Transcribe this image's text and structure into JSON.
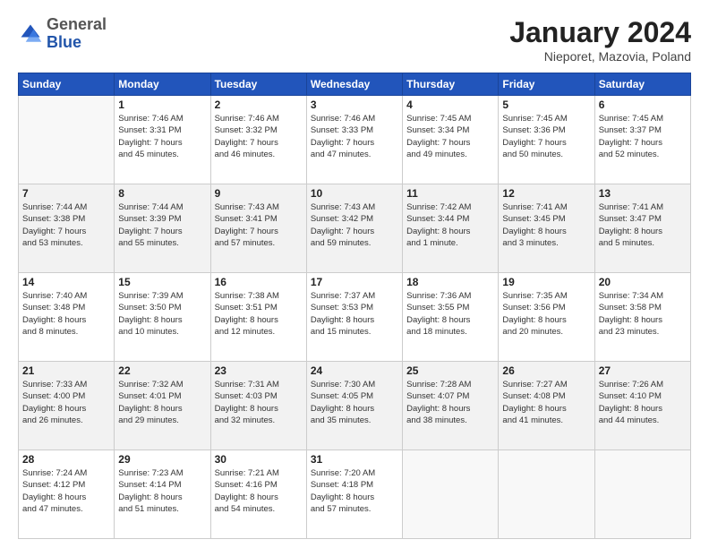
{
  "header": {
    "logo_general": "General",
    "logo_blue": "Blue",
    "title": "January 2024",
    "subtitle": "Nieporet, Mazovia, Poland"
  },
  "days_of_week": [
    "Sunday",
    "Monday",
    "Tuesday",
    "Wednesday",
    "Thursday",
    "Friday",
    "Saturday"
  ],
  "weeks": [
    [
      {
        "num": "",
        "info": ""
      },
      {
        "num": "1",
        "info": "Sunrise: 7:46 AM\nSunset: 3:31 PM\nDaylight: 7 hours\nand 45 minutes."
      },
      {
        "num": "2",
        "info": "Sunrise: 7:46 AM\nSunset: 3:32 PM\nDaylight: 7 hours\nand 46 minutes."
      },
      {
        "num": "3",
        "info": "Sunrise: 7:46 AM\nSunset: 3:33 PM\nDaylight: 7 hours\nand 47 minutes."
      },
      {
        "num": "4",
        "info": "Sunrise: 7:45 AM\nSunset: 3:34 PM\nDaylight: 7 hours\nand 49 minutes."
      },
      {
        "num": "5",
        "info": "Sunrise: 7:45 AM\nSunset: 3:36 PM\nDaylight: 7 hours\nand 50 minutes."
      },
      {
        "num": "6",
        "info": "Sunrise: 7:45 AM\nSunset: 3:37 PM\nDaylight: 7 hours\nand 52 minutes."
      }
    ],
    [
      {
        "num": "7",
        "info": "Sunrise: 7:44 AM\nSunset: 3:38 PM\nDaylight: 7 hours\nand 53 minutes."
      },
      {
        "num": "8",
        "info": "Sunrise: 7:44 AM\nSunset: 3:39 PM\nDaylight: 7 hours\nand 55 minutes."
      },
      {
        "num": "9",
        "info": "Sunrise: 7:43 AM\nSunset: 3:41 PM\nDaylight: 7 hours\nand 57 minutes."
      },
      {
        "num": "10",
        "info": "Sunrise: 7:43 AM\nSunset: 3:42 PM\nDaylight: 7 hours\nand 59 minutes."
      },
      {
        "num": "11",
        "info": "Sunrise: 7:42 AM\nSunset: 3:44 PM\nDaylight: 8 hours\nand 1 minute."
      },
      {
        "num": "12",
        "info": "Sunrise: 7:41 AM\nSunset: 3:45 PM\nDaylight: 8 hours\nand 3 minutes."
      },
      {
        "num": "13",
        "info": "Sunrise: 7:41 AM\nSunset: 3:47 PM\nDaylight: 8 hours\nand 5 minutes."
      }
    ],
    [
      {
        "num": "14",
        "info": "Sunrise: 7:40 AM\nSunset: 3:48 PM\nDaylight: 8 hours\nand 8 minutes."
      },
      {
        "num": "15",
        "info": "Sunrise: 7:39 AM\nSunset: 3:50 PM\nDaylight: 8 hours\nand 10 minutes."
      },
      {
        "num": "16",
        "info": "Sunrise: 7:38 AM\nSunset: 3:51 PM\nDaylight: 8 hours\nand 12 minutes."
      },
      {
        "num": "17",
        "info": "Sunrise: 7:37 AM\nSunset: 3:53 PM\nDaylight: 8 hours\nand 15 minutes."
      },
      {
        "num": "18",
        "info": "Sunrise: 7:36 AM\nSunset: 3:55 PM\nDaylight: 8 hours\nand 18 minutes."
      },
      {
        "num": "19",
        "info": "Sunrise: 7:35 AM\nSunset: 3:56 PM\nDaylight: 8 hours\nand 20 minutes."
      },
      {
        "num": "20",
        "info": "Sunrise: 7:34 AM\nSunset: 3:58 PM\nDaylight: 8 hours\nand 23 minutes."
      }
    ],
    [
      {
        "num": "21",
        "info": "Sunrise: 7:33 AM\nSunset: 4:00 PM\nDaylight: 8 hours\nand 26 minutes."
      },
      {
        "num": "22",
        "info": "Sunrise: 7:32 AM\nSunset: 4:01 PM\nDaylight: 8 hours\nand 29 minutes."
      },
      {
        "num": "23",
        "info": "Sunrise: 7:31 AM\nSunset: 4:03 PM\nDaylight: 8 hours\nand 32 minutes."
      },
      {
        "num": "24",
        "info": "Sunrise: 7:30 AM\nSunset: 4:05 PM\nDaylight: 8 hours\nand 35 minutes."
      },
      {
        "num": "25",
        "info": "Sunrise: 7:28 AM\nSunset: 4:07 PM\nDaylight: 8 hours\nand 38 minutes."
      },
      {
        "num": "26",
        "info": "Sunrise: 7:27 AM\nSunset: 4:08 PM\nDaylight: 8 hours\nand 41 minutes."
      },
      {
        "num": "27",
        "info": "Sunrise: 7:26 AM\nSunset: 4:10 PM\nDaylight: 8 hours\nand 44 minutes."
      }
    ],
    [
      {
        "num": "28",
        "info": "Sunrise: 7:24 AM\nSunset: 4:12 PM\nDaylight: 8 hours\nand 47 minutes."
      },
      {
        "num": "29",
        "info": "Sunrise: 7:23 AM\nSunset: 4:14 PM\nDaylight: 8 hours\nand 51 minutes."
      },
      {
        "num": "30",
        "info": "Sunrise: 7:21 AM\nSunset: 4:16 PM\nDaylight: 8 hours\nand 54 minutes."
      },
      {
        "num": "31",
        "info": "Sunrise: 7:20 AM\nSunset: 4:18 PM\nDaylight: 8 hours\nand 57 minutes."
      },
      {
        "num": "",
        "info": ""
      },
      {
        "num": "",
        "info": ""
      },
      {
        "num": "",
        "info": ""
      }
    ]
  ]
}
